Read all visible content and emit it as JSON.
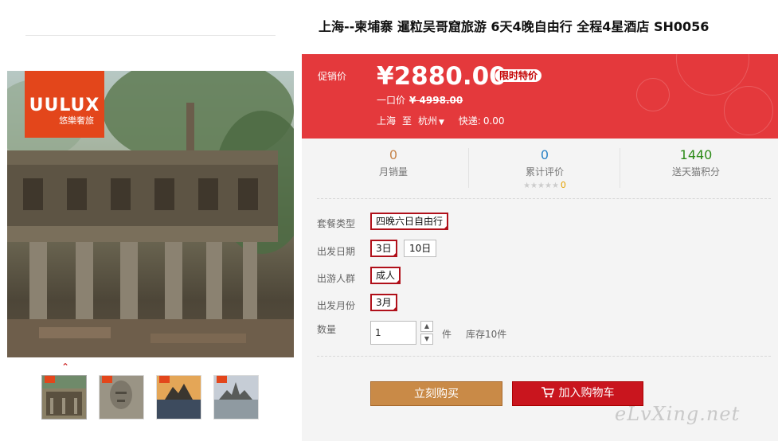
{
  "product": {
    "title": "上海--柬埔寨 暹粒吴哥窟旅游 6天4晚自由行 全程4星酒店 SH0056"
  },
  "gallery": {
    "brand_name": "UULUX",
    "brand_sub": "悠樂奢旅",
    "thumbnail_count": 4
  },
  "price": {
    "promo_label": "促销价",
    "current": "¥2880.00",
    "badge": "限时特价",
    "original_label": "一口价",
    "original": "¥ 4998.00"
  },
  "shipping": {
    "from": "上海",
    "to_label": "至",
    "destination": "杭州",
    "fee_label": "快递:",
    "fee": "0.00"
  },
  "stats": {
    "monthly_sales": {
      "value": "0",
      "label": "月销量",
      "color": "#c6844a"
    },
    "reviews": {
      "value": "0",
      "label": "累计评价",
      "stars": "★★★★★",
      "score": "0",
      "color": "#2c83c6"
    },
    "points": {
      "value": "1440",
      "label": "送天猫积分",
      "color": "#2b8a16"
    }
  },
  "options": {
    "package": {
      "label": "套餐类型",
      "choices": [
        "四晚六日自由行"
      ],
      "selected": "四晚六日自由行"
    },
    "departure_date": {
      "label": "出发日期",
      "choices": [
        "3日",
        "10日"
      ],
      "selected": "3日"
    },
    "travelers": {
      "label": "出游人群",
      "choices": [
        "成人"
      ],
      "selected": "成人"
    },
    "month": {
      "label": "出发月份",
      "choices": [
        "3月"
      ],
      "selected": "3月"
    }
  },
  "quantity": {
    "label": "数量",
    "value": "1",
    "unit": "件",
    "stock": "库存10件"
  },
  "actions": {
    "buy_now": "立刻购买",
    "add_to_cart": "加入购物车"
  },
  "watermark": "eLvXing.net",
  "colors": {
    "promo_bg": "#e4393c",
    "buy_button": "#c98a47",
    "cart_button": "#c9151e",
    "selected_border": "#b0101a",
    "brand_badge": "#e3461b"
  }
}
